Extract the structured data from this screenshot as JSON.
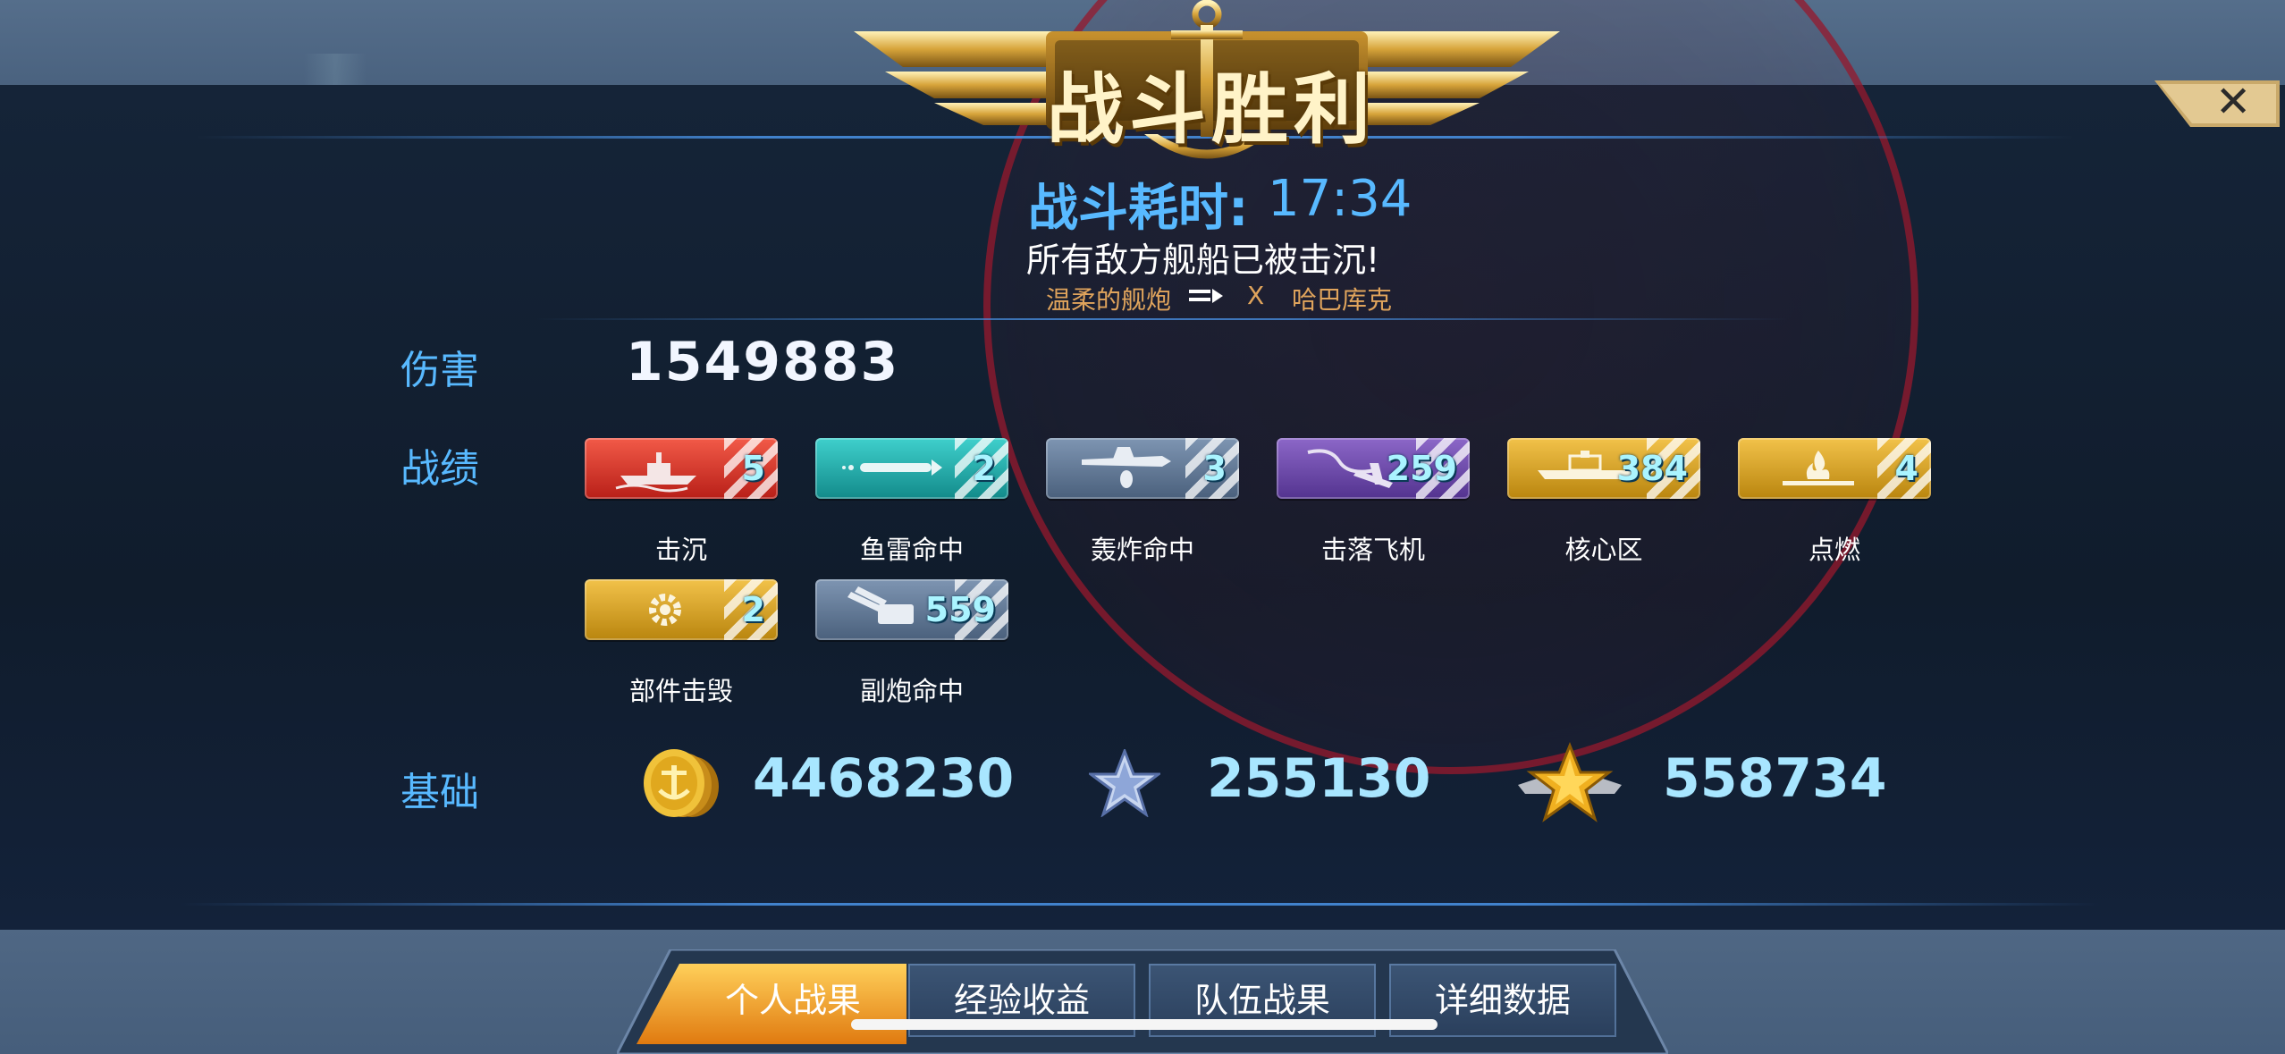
{
  "header": {
    "title": "战斗胜利",
    "close_label": "✕"
  },
  "battle": {
    "time_label": "战斗耗时:",
    "time_value": "17:34",
    "message": "所有敌方舰船已被击沉!",
    "sub_left": "温柔的舰炮",
    "sub_x": "X",
    "sub_right": "哈巴库克"
  },
  "damage": {
    "label": "伤害",
    "value": "1549883"
  },
  "record": {
    "label": "战绩",
    "badges": [
      {
        "name": "击沉",
        "value": "5",
        "icon": "ship-sinking-icon",
        "color": "#d8352a"
      },
      {
        "name": "鱼雷命中",
        "value": "2",
        "icon": "torpedo-icon",
        "color": "#1aa6a6"
      },
      {
        "name": "轰炸命中",
        "value": "3",
        "icon": "bomber-icon",
        "color": "#5c7390"
      },
      {
        "name": "击落飞机",
        "value": "259",
        "icon": "plane-down-icon",
        "color": "#6c4aa6"
      },
      {
        "name": "核心区",
        "value": "384",
        "icon": "citadel-icon",
        "color": "#d6a31c"
      },
      {
        "name": "点燃",
        "value": "4",
        "icon": "fire-icon",
        "color": "#d6a31c"
      },
      {
        "name": "部件击毁",
        "value": "2",
        "icon": "gear-icon",
        "color": "#d6a31c"
      },
      {
        "name": "副炮命中",
        "value": "559",
        "icon": "secondary-gun-icon",
        "color": "#5c7390"
      }
    ]
  },
  "base": {
    "label": "基础",
    "coins": "4468230",
    "exp": "255130",
    "free_exp": "558734"
  },
  "tabs": [
    {
      "label": "个人战果",
      "active": true
    },
    {
      "label": "经验收益",
      "active": false
    },
    {
      "label": "队伍战果",
      "active": false
    },
    {
      "label": "详细数据",
      "active": false
    }
  ]
}
